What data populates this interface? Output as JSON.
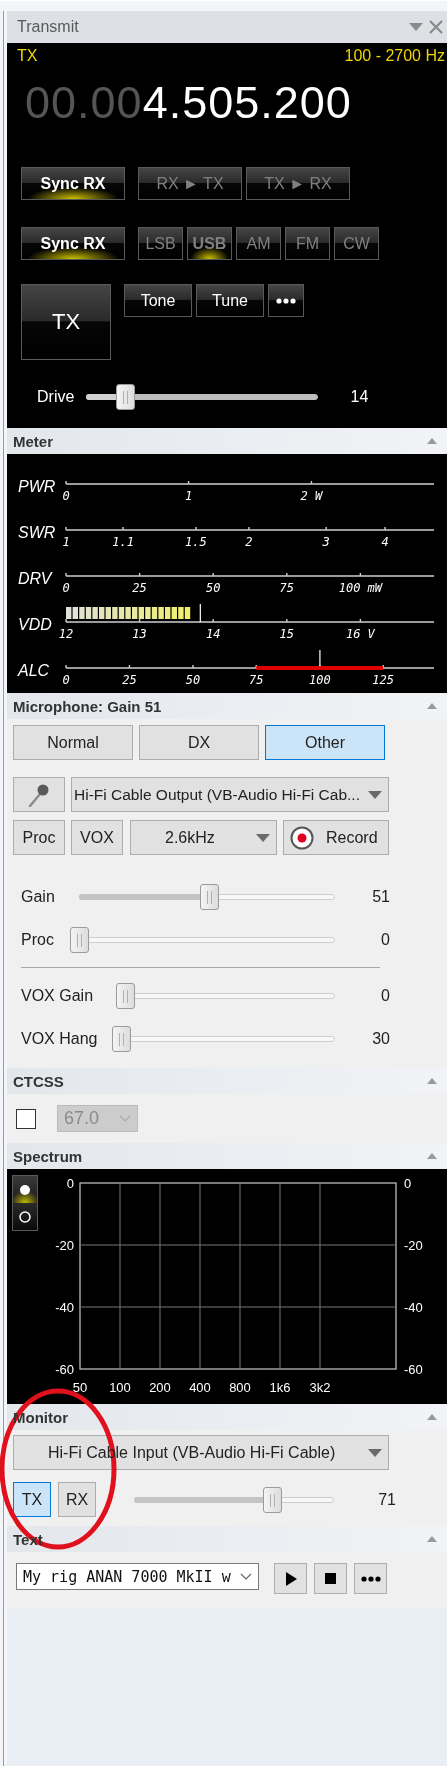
{
  "window": {
    "title": "Transmit"
  },
  "transmit": {
    "label": "TX",
    "passband": "100 - 2700 Hz",
    "frequency_leading": "00.00",
    "frequency": "4.505.200",
    "sync_buttons": [
      {
        "label": "Sync RX",
        "on": true,
        "disabled": false
      },
      {
        "label": "RX ► TX",
        "on": false,
        "disabled": true
      },
      {
        "label": "TX ► RX",
        "on": false,
        "disabled": true
      }
    ],
    "mode_sync": {
      "label": "Sync RX",
      "on": true
    },
    "modes": [
      {
        "label": "LSB",
        "selected": false
      },
      {
        "label": "USB",
        "selected": true
      },
      {
        "label": "AM",
        "selected": false
      },
      {
        "label": "FM",
        "selected": false
      },
      {
        "label": "CW",
        "selected": false
      }
    ],
    "tx_button": {
      "label": "TX",
      "on": false
    },
    "tool_buttons": [
      {
        "kind": "label",
        "label": "Tone"
      },
      {
        "kind": "label",
        "label": "Tune"
      },
      {
        "kind": "more"
      }
    ],
    "drive": {
      "label": "Drive",
      "level": 0.14,
      "reading": "14"
    }
  },
  "meter": {
    "title": "Meter",
    "rows": [
      {
        "label": "PWR",
        "kind": "scale",
        "ticks": [
          "0",
          "1",
          "2 W"
        ]
      },
      {
        "label": "SWR",
        "kind": "scale",
        "ticks": [
          "1",
          "1.1",
          "1.5",
          "2",
          "3",
          "4"
        ]
      },
      {
        "label": "DRV",
        "kind": "scale",
        "ticks": [
          "0",
          "25",
          "50",
          "75",
          "100 mW"
        ]
      },
      {
        "label": "VDD",
        "kind": "bar",
        "ticks": [
          "12",
          "13",
          "14",
          "15",
          "16 V"
        ]
      },
      {
        "label": "ALC",
        "kind": "zone",
        "ticks": [
          "0",
          "25",
          "50",
          "75",
          "100",
          "125"
        ]
      }
    ]
  },
  "microphone": {
    "title": "Microphone: Gain 51",
    "presets": [
      {
        "label": "Normal",
        "selected": false
      },
      {
        "label": "DX",
        "selected": false
      },
      {
        "label": "Other",
        "selected": true
      }
    ],
    "device": "Hi-Fi Cable Output (VB-Audio Hi-Fi Cab...",
    "toggles": [
      {
        "label": "Proc",
        "selected": false
      },
      {
        "label": "VOX",
        "selected": false
      }
    ],
    "filter": "2.6kHz",
    "record": "Record",
    "sliders": [
      {
        "label": "Gain",
        "level": 0.51,
        "reading": "51"
      },
      {
        "label": "Proc",
        "level": 0,
        "reading": "0"
      }
    ],
    "vox_sliders": [
      {
        "label": "VOX Gain",
        "level": 0,
        "reading": "0"
      },
      {
        "label": "VOX Hang",
        "level": 0,
        "reading": "30"
      }
    ]
  },
  "ctcss": {
    "title": "CTCSS",
    "checked": false,
    "tone": "67.0",
    "disabled": true
  },
  "spectrum": {
    "title": "Spectrum",
    "views": [
      {
        "selected": true
      },
      {
        "selected": false
      }
    ],
    "chart_data": {
      "type": "line",
      "grid": true,
      "categories": [
        "50",
        "100",
        "200",
        "400",
        "800",
        "1k6",
        "3k2"
      ],
      "ylim": [
        -60,
        0
      ],
      "yticks": [
        0,
        -20,
        -40,
        -60
      ]
    },
    "right_axis_labels": [
      "0",
      "-20",
      "-40",
      "-60"
    ]
  },
  "monitor": {
    "title": "Monitor",
    "device": "Hi-Fi Cable Input (VB-Audio Hi-Fi Cable)",
    "sources": [
      {
        "label": "TX",
        "selected": true
      },
      {
        "label": "RX",
        "selected": false
      }
    ],
    "volume": {
      "level": 0.71,
      "reading": "71"
    }
  },
  "text": {
    "title": "Text",
    "message": "My rig ANAN 7000 MkII w",
    "buttons": [
      {
        "kind": "play"
      },
      {
        "kind": "stop"
      },
      {
        "kind": "more"
      }
    ]
  },
  "annotation": {
    "kind": "ellipse",
    "color": "#e0101c"
  }
}
